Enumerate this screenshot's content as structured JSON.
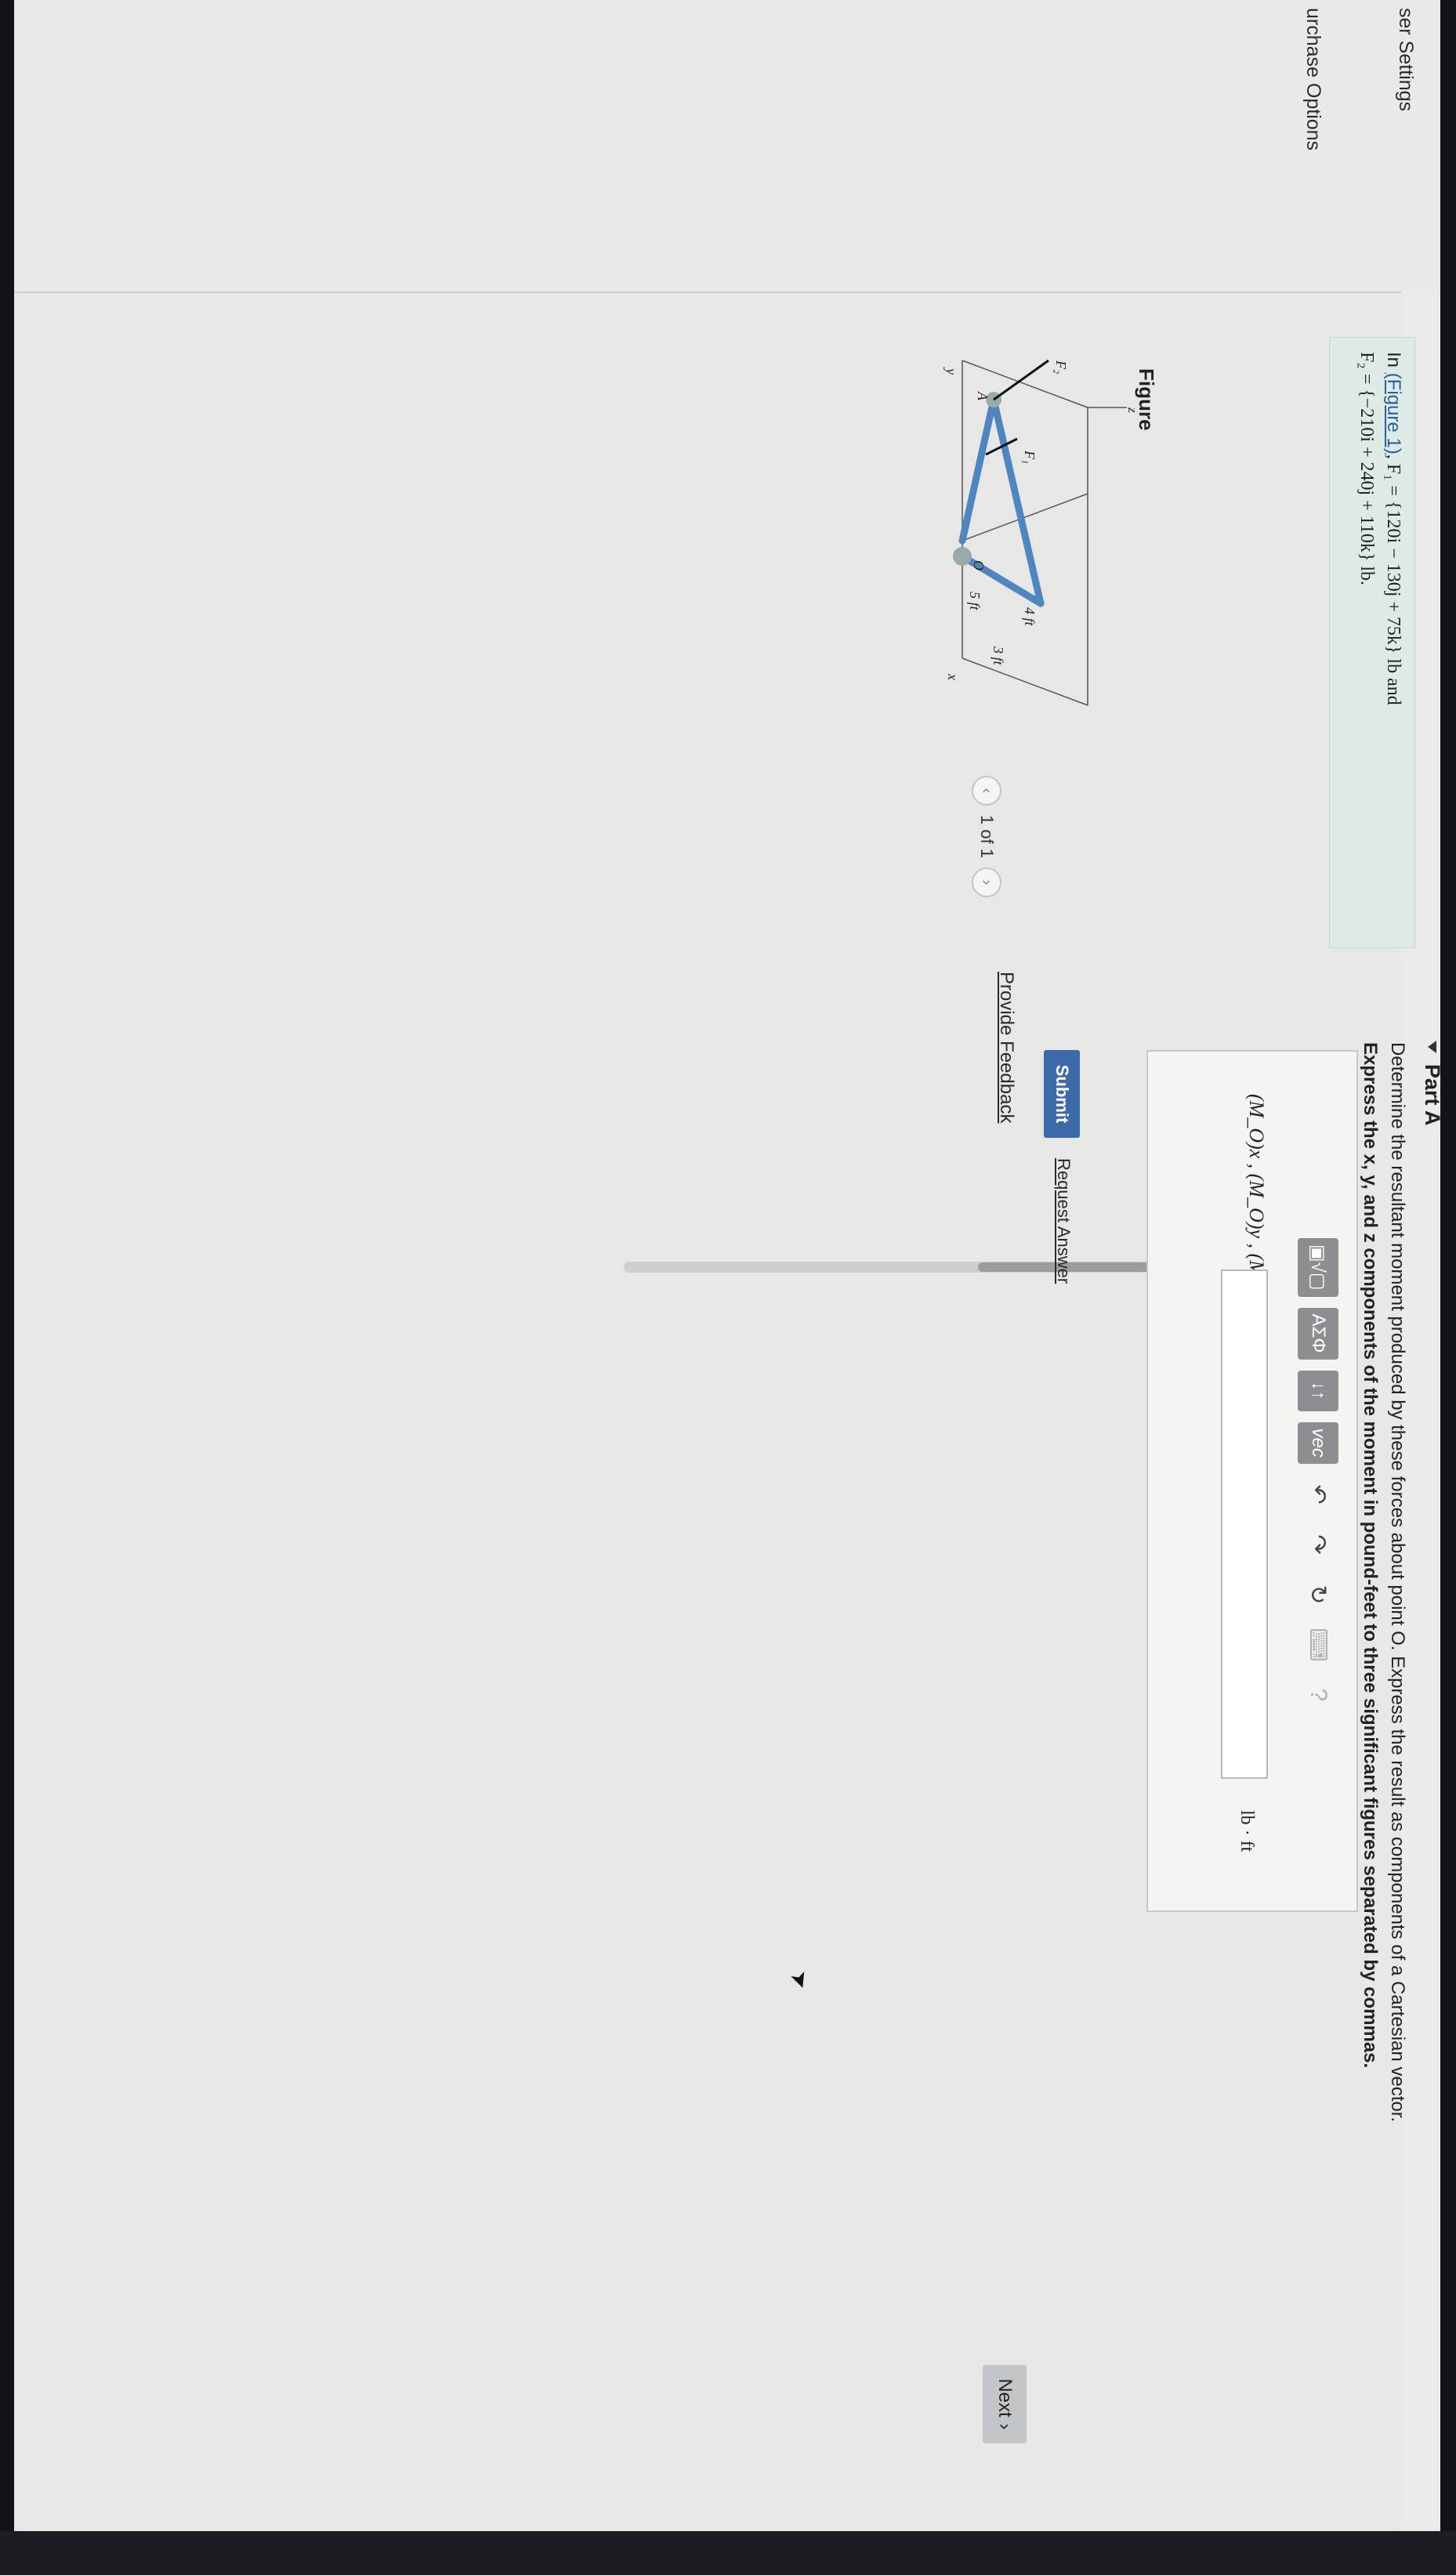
{
  "nav": {
    "items": [
      {
        "label": "ser Settings"
      },
      {
        "label": "urchase Options"
      }
    ]
  },
  "intro": {
    "prefix": "In ",
    "figure_link": "(Figure 1)",
    "f1": ", F₁ = {120i − 130j + 75k} lb and",
    "f2": "F₂ = {−210i + 240j + 110k} lb."
  },
  "figure": {
    "title": "Figure",
    "pager": {
      "prev_icon": "chevron-left-icon",
      "text": "1 of 1",
      "next_icon": "chevron-right-icon"
    },
    "labels": {
      "dim1": "4 ft",
      "dim2": "5 ft",
      "dim3": "3 ft",
      "point_o": "O",
      "point_a": "A",
      "f1": "F₁",
      "f2": "F₂",
      "axis_x": "x",
      "axis_y": "y",
      "axis_z": "z"
    }
  },
  "part": {
    "title": "Part A",
    "question": "Determine the resultant moment produced by these forces about point O. Express the result as components of a Cartesian vector.",
    "instruction": "Express the x, y, and z components of the moment in pound-feet to three significant figures separated by commas."
  },
  "answer": {
    "label": "(M_O)x , (M_O)y , (M_O)z =",
    "value": "",
    "unit": "lb · ft",
    "toolbar": {
      "template": "▣√▢",
      "greek": "ΑΣΦ",
      "arrows": "↓↑",
      "vec": "vec",
      "undo_icon": "undo-icon",
      "redo_icon": "redo-icon",
      "reset_icon": "reset-icon",
      "keyboard_icon": "keyboard-icon",
      "help": "?"
    }
  },
  "actions": {
    "submit": "Submit",
    "request_answer": "Request Answer",
    "provide_feedback": "Provide Feedback",
    "next": "Next"
  },
  "colors": {
    "submit_bg": "#3d6aa8",
    "intro_bg": "#ddeae6",
    "truss": "#4f86bf",
    "toolbar_btn": "#8d8e91"
  }
}
